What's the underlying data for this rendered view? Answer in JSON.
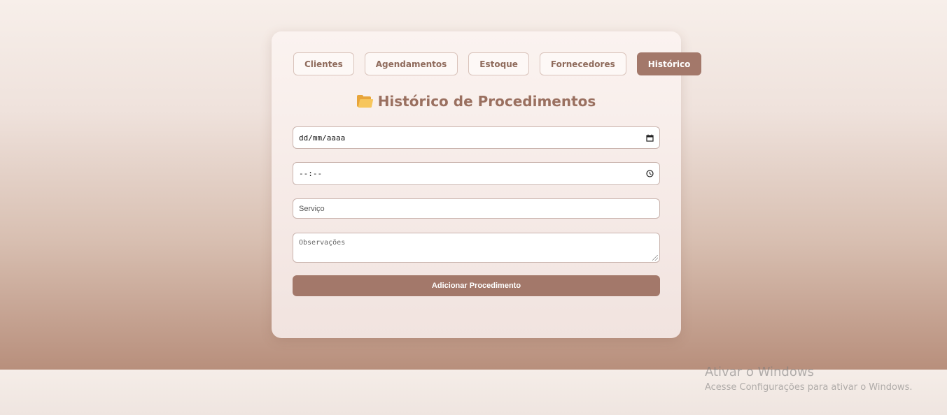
{
  "tabs": [
    {
      "label": "Clientes",
      "active": false
    },
    {
      "label": "Agendamentos",
      "active": false
    },
    {
      "label": "Estoque",
      "active": false
    },
    {
      "label": "Fornecedores",
      "active": false
    },
    {
      "label": "Histórico",
      "active": true
    }
  ],
  "page": {
    "title": "Histórico de Procedimentos",
    "title_icon": "folder-open-icon"
  },
  "form": {
    "date_placeholder": "dd/mm/aaaa",
    "date_icon": "calendar-icon",
    "time_placeholder": "--:--",
    "time_icon": "clock-icon",
    "service_placeholder": "Serviço",
    "notes_placeholder": "Observações",
    "submit_label": "Adicionar Procedimento"
  },
  "watermark": {
    "line1": "Ativar o Windows",
    "line2": "Acesse Configurações para ativar o Windows."
  },
  "colors": {
    "accent": "#a3786a",
    "title_text": "#9a7060",
    "tab_text": "#8f6b5c"
  }
}
